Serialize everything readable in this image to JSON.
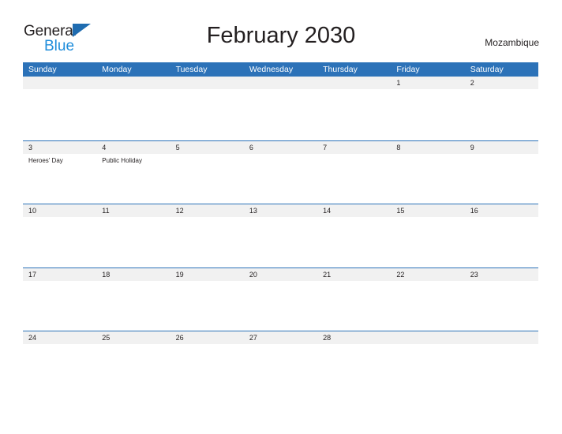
{
  "brand": {
    "name_part1": "General",
    "name_part2": "Blue",
    "color_dark": "#231f20",
    "color_blue": "#1f8ddb",
    "flag_color": "#1f6cb0"
  },
  "header": {
    "title": "February 2030",
    "country": "Mozambique"
  },
  "theme": {
    "header_blue": "#2c72b8",
    "date_band_gray": "#f1f1f1",
    "text_color": "#231f20"
  },
  "weekdays": [
    "Sunday",
    "Monday",
    "Tuesday",
    "Wednesday",
    "Thursday",
    "Friday",
    "Saturday"
  ],
  "weeks": [
    {
      "days": [
        {
          "num": "",
          "events": []
        },
        {
          "num": "",
          "events": []
        },
        {
          "num": "",
          "events": []
        },
        {
          "num": "",
          "events": []
        },
        {
          "num": "",
          "events": []
        },
        {
          "num": "1",
          "events": []
        },
        {
          "num": "2",
          "events": []
        }
      ]
    },
    {
      "days": [
        {
          "num": "3",
          "events": [
            "Heroes' Day"
          ]
        },
        {
          "num": "4",
          "events": [
            "Public Holiday"
          ]
        },
        {
          "num": "5",
          "events": []
        },
        {
          "num": "6",
          "events": []
        },
        {
          "num": "7",
          "events": []
        },
        {
          "num": "8",
          "events": []
        },
        {
          "num": "9",
          "events": []
        }
      ]
    },
    {
      "days": [
        {
          "num": "10",
          "events": []
        },
        {
          "num": "11",
          "events": []
        },
        {
          "num": "12",
          "events": []
        },
        {
          "num": "13",
          "events": []
        },
        {
          "num": "14",
          "events": []
        },
        {
          "num": "15",
          "events": []
        },
        {
          "num": "16",
          "events": []
        }
      ]
    },
    {
      "days": [
        {
          "num": "17",
          "events": []
        },
        {
          "num": "18",
          "events": []
        },
        {
          "num": "19",
          "events": []
        },
        {
          "num": "20",
          "events": []
        },
        {
          "num": "21",
          "events": []
        },
        {
          "num": "22",
          "events": []
        },
        {
          "num": "23",
          "events": []
        }
      ]
    },
    {
      "days": [
        {
          "num": "24",
          "events": []
        },
        {
          "num": "25",
          "events": []
        },
        {
          "num": "26",
          "events": []
        },
        {
          "num": "27",
          "events": []
        },
        {
          "num": "28",
          "events": []
        },
        {
          "num": "",
          "events": []
        },
        {
          "num": "",
          "events": []
        }
      ]
    }
  ]
}
